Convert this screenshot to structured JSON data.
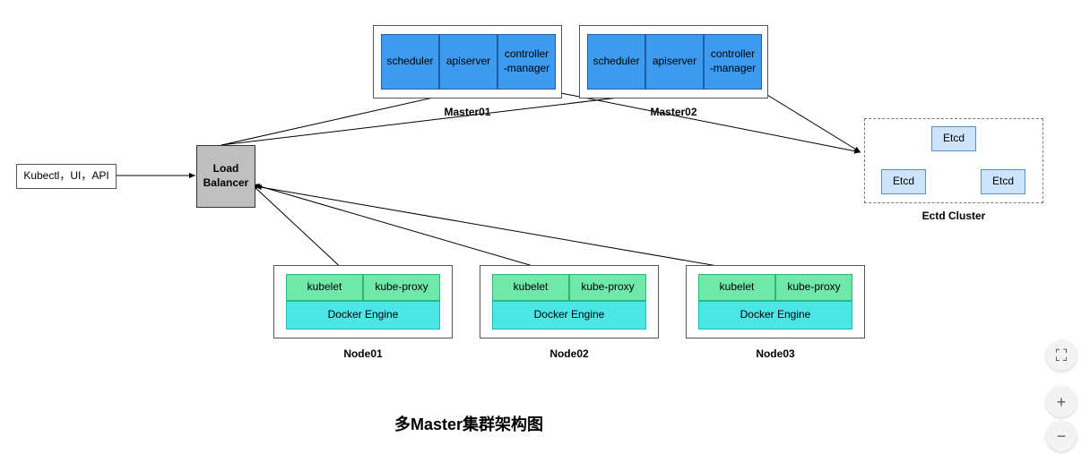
{
  "client": {
    "label": "Kubectl，UI，API"
  },
  "loadbalancer": {
    "label": "Load\nBalancer"
  },
  "masters": [
    {
      "label": "Master01",
      "components": {
        "scheduler": "scheduler",
        "apiserver": "apiserver",
        "controller": "controller\n-manager"
      }
    },
    {
      "label": "Master02",
      "components": {
        "scheduler": "scheduler",
        "apiserver": "apiserver",
        "controller": "controller\n-manager"
      }
    }
  ],
  "etcd_cluster": {
    "label": "Ectd Cluster",
    "nodes": {
      "top": "Etcd",
      "left": "Etcd",
      "right": "Etcd"
    }
  },
  "nodes": [
    {
      "label": "Node01",
      "kubelet": "kubelet",
      "kubeproxy": "kube-proxy",
      "docker": "Docker Engine"
    },
    {
      "label": "Node02",
      "kubelet": "kubelet",
      "kubeproxy": "kube-proxy",
      "docker": "Docker Engine"
    },
    {
      "label": "Node03",
      "kubelet": "kubelet",
      "kubeproxy": "kube-proxy",
      "docker": "Docker Engine"
    }
  ],
  "title": "多Master集群架构图",
  "controls": {
    "fullscreen": "⛶",
    "zoom_in": "+",
    "zoom_out": "−"
  }
}
